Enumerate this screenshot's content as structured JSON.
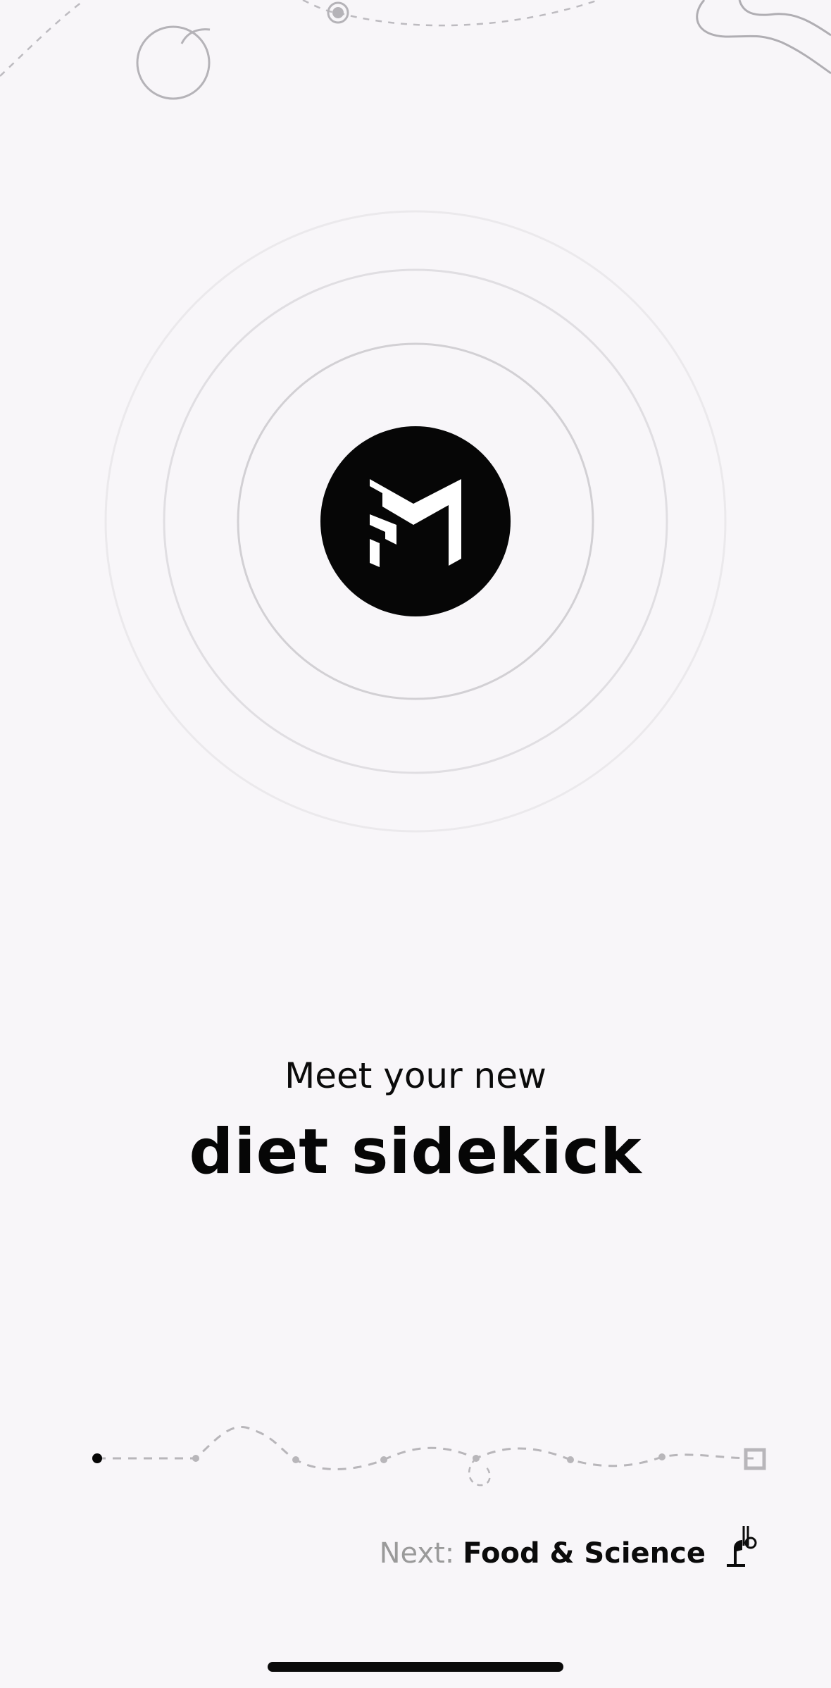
{
  "onboarding": {
    "intro_line": "Meet your new",
    "headline": "diet sidekick",
    "progress": {
      "step": 1,
      "total": 8
    },
    "next": {
      "label": "Next:",
      "title": "Food & Science"
    }
  },
  "icons": {
    "logo": "m-brand-logo",
    "next_step": "boot-icon",
    "progress_end": "square-marker-icon"
  },
  "colors": {
    "background": "#f8f6f9",
    "logo_fill": "#060606",
    "primary_text": "#0b0b0b",
    "muted_text": "#9a9a9a",
    "ring_stroke": "#d4d2d6",
    "path_stroke": "#b8b6ba"
  }
}
